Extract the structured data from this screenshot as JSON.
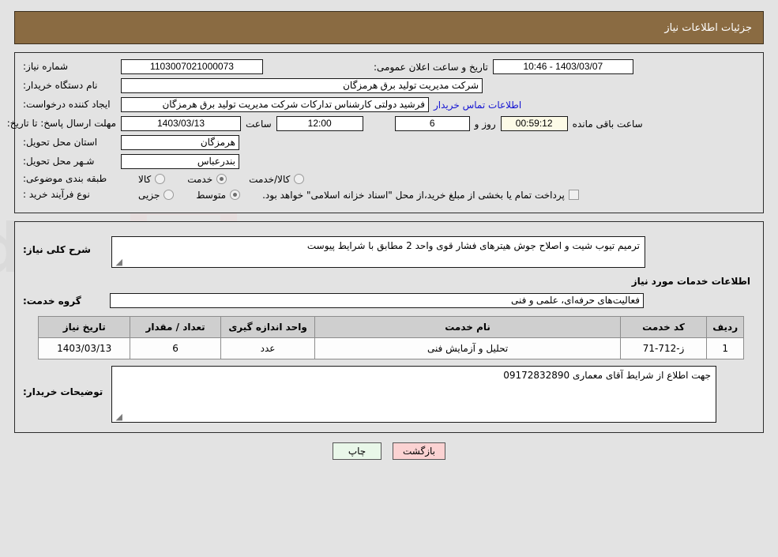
{
  "header": {
    "title": "جزئیات اطلاعات نیاز"
  },
  "form": {
    "need_no_label": "شماره نیاز:",
    "need_no_value": "1103007021000073",
    "announce_label": "تاریخ و ساعت اعلان عمومی:",
    "announce_value": "1403/03/07 - 10:46",
    "buyer_org_label": "نام دستگاه خریدار:",
    "buyer_org_value": "شرکت مدیریت تولید برق هرمزگان",
    "creator_label": "ایجاد کننده درخواست:",
    "creator_value": "فرشید دولتی کارشناس تدارکات شرکت مدیریت تولید برق هرمزگان",
    "contact_link": "اطلاعات تماس خریدار",
    "deadline_label": "مهلت ارسال پاسخ: تا تاریخ:",
    "deadline_date": "1403/03/13",
    "hour_label": "ساعت",
    "deadline_time": "12:00",
    "days_value": "6",
    "days_label": "روز و",
    "countdown_value": "00:59:12",
    "remaining_label": "ساعت باقی مانده",
    "province_label": "استان محل تحویل:",
    "province_value": "هرمزگان",
    "city_label": "شـهر محل تحویل:",
    "city_value": "بندرعباس",
    "category_label": "طبقه بندی موضوعی:",
    "category_options": [
      {
        "label": "کالا",
        "selected": false
      },
      {
        "label": "خدمت",
        "selected": true
      },
      {
        "label": "کالا/خدمت",
        "selected": false
      }
    ],
    "process_label": "نوع فرآیند خرید :",
    "process_options": [
      {
        "label": "جزیی",
        "selected": false
      },
      {
        "label": "متوسط",
        "selected": true
      }
    ],
    "treasury_checkbox_label": "پرداخت تمام یا بخشی از مبلغ خرید،از محل \"اسناد خزانه اسلامی\" خواهد بود.",
    "treasury_checked": false
  },
  "details": {
    "need_desc_label": "شرح کلی نیاز:",
    "need_desc_value": "ترمیم تیوب شیت و اصلاح جوش هیترهای فشار قوی واحد 2 مطابق با شرایط پیوست",
    "services_section_title": "اطلاعات خدمات مورد نیاز",
    "service_group_label": "گروه خدمت:",
    "service_group_value": "فعالیت‌های حرفه‌ای، علمی و فنی"
  },
  "table": {
    "headers": [
      "ردیف",
      "کد خدمت",
      "نام خدمت",
      "واحد اندازه گیری",
      "تعداد / مقدار",
      "تاریخ نیاز"
    ],
    "rows": [
      {
        "radif": "1",
        "code": "ز-712-71",
        "name": "تحلیل و آزمایش فنی",
        "unit": "عدد",
        "qty": "6",
        "date": "1403/03/13"
      }
    ]
  },
  "notes": {
    "label": "توضیحات خریدار:",
    "value": "جهت اطلاع از شرایط آقای معماری 09172832890"
  },
  "footer": {
    "print_label": "چاپ",
    "back_label": "بازگشت"
  },
  "watermark": {
    "text": "AriaTender.net"
  },
  "colors": {
    "header_bg": "#8a6b42",
    "link": "#1414d2",
    "countdown_bg": "#fdfbe7",
    "btn_print_bg": "#e9f7e9",
    "btn_back_bg": "#fbd2d2",
    "table_header_bg": "#cfcfcf"
  }
}
